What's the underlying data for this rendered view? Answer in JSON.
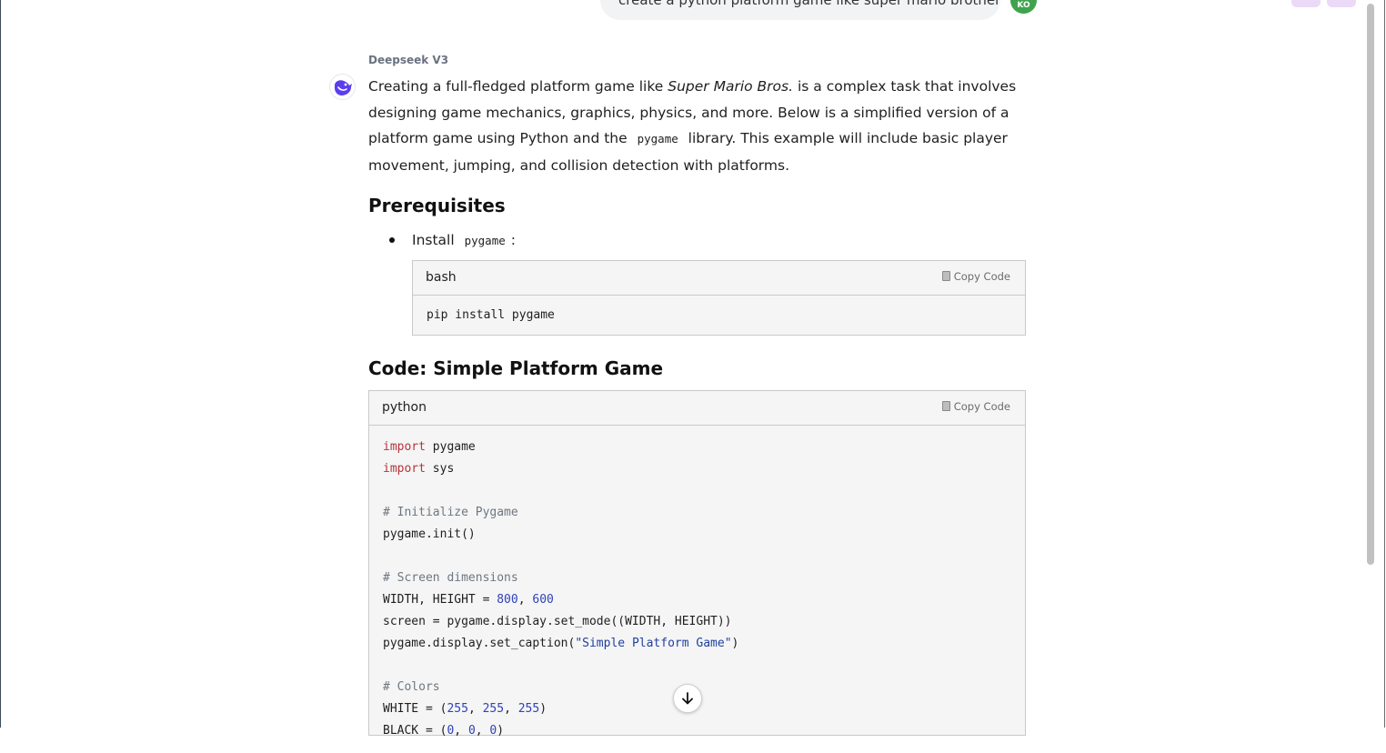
{
  "user_message": {
    "text": "create a python platform game like super mario brothers",
    "avatar_initials": "KO"
  },
  "response": {
    "model_name": "Deepseek V3",
    "intro": {
      "part1": "Creating a full-fledged platform game like ",
      "italic": "Super Mario Bros.",
      "part2": " is a complex task that involves designing game mechanics, graphics, physics, and more. Below is a simplified version of a platform game using Python and the ",
      "code": "pygame",
      "part3": " library. This example will include basic player movement, jumping, and collision detection with platforms."
    },
    "prereq_heading": "Prerequisites",
    "bullet": {
      "prefix": "Install ",
      "code": "pygame",
      "suffix": ":"
    },
    "bash_block": {
      "lang": "bash",
      "copy_label": "Copy Code",
      "code": "pip install pygame"
    },
    "code_heading": "Code: Simple Platform Game",
    "python_block": {
      "lang": "python",
      "copy_label": "Copy Code"
    }
  },
  "colors": {
    "user_avatar": "#3fa34d",
    "model_logo": "#5b3df0",
    "keyword": "#b4343c",
    "comment": "#6e7781",
    "number": "#2f42b8"
  },
  "icons": [
    "deepseek-logo-icon",
    "clipboard-icon",
    "arrow-down-icon"
  ]
}
